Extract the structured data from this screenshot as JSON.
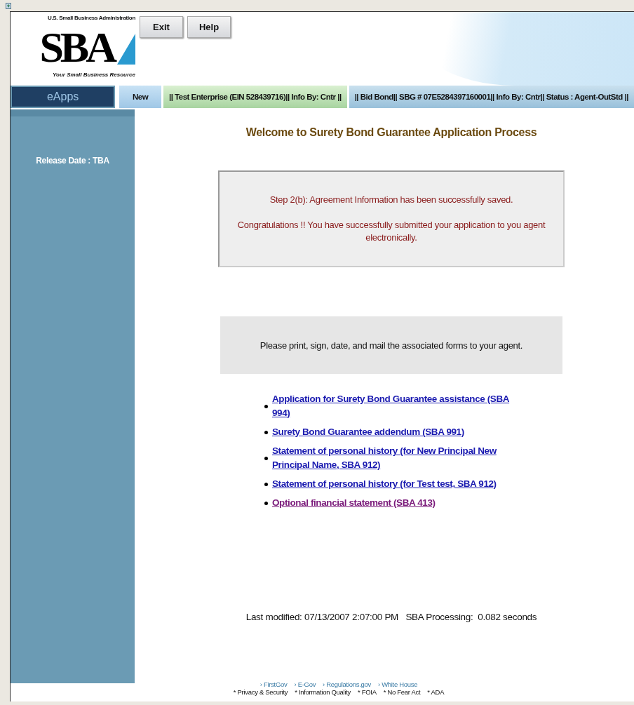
{
  "logo": {
    "agency": "U.S. Small Business Administration",
    "mark": "SBA",
    "tagline": "Your Small Business Resource"
  },
  "header_buttons": [
    "Exit",
    "Help"
  ],
  "sidebar": {
    "title": "eApps",
    "release": "Release Date : TBA"
  },
  "nav": [
    {
      "label": "New",
      "kind": "action"
    },
    {
      "label": "|| Test Enterprise (EIN 528439716)|| Info By:  Cntr ||",
      "kind": "info"
    },
    {
      "label": "|| Bid Bond|| SBG # 07E5284397160001|| Info By:  Cntr|| Status :  Agent-OutStd ||",
      "kind": "status"
    }
  ],
  "heading": "Welcome to Surety Bond Guarantee Application Process",
  "message": [
    "Step 2(b): Agreement Information has been successfully saved.",
    "Congratulations !! You have successfully submitted your application to you agent electronically."
  ],
  "instruction": "Please print, sign, date, and mail the associated forms to your agent.",
  "forms": [
    {
      "label": "Application for Surety Bond Guarantee assistance (SBA 994)",
      "visited": false
    },
    {
      "label": "Surety Bond Guarantee addendum (SBA 991)",
      "visited": false
    },
    {
      "label": "Statement of personal history (for New Principal New Principal Name, SBA 912)",
      "visited": false
    },
    {
      "label": "Statement of personal history (for Test test, SBA 912)",
      "visited": false
    },
    {
      "label": "Optional financial statement (SBA 413)",
      "visited": true
    }
  ],
  "last_modified": "Last modified: 07/13/2007 2:07:00 PM   SBA Processing:  0.082 seconds",
  "footer": {
    "links": [
      "› FirstGov",
      "› E-Gov",
      "› Regulations.gov",
      "› White House"
    ],
    "policies": [
      "* Privacy & Security",
      "* Information Quality",
      "* FOIA",
      "* No Fear Act",
      "* ADA"
    ]
  }
}
